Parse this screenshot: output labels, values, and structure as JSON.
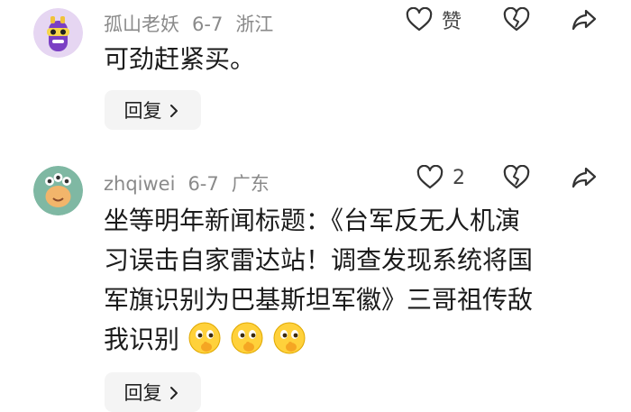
{
  "comments": [
    {
      "username": "孤山老妖",
      "date": "6-7",
      "location": "浙江",
      "text": "可劲赶紧买。",
      "reply_label": "回复",
      "like_label": "赞",
      "avatar_icon": "purple-cartoon-avatar"
    },
    {
      "username": "zhqiwei",
      "date": "6-7",
      "location": "广东",
      "text_lines": [
        "坐等明年新闻标题：《台军反无人机演",
        "习误击自家雷达站！调查发现系统将国",
        "军旗识别为巴基斯坦军徽》三哥祖传敌",
        "我识别"
      ],
      "emojis": [
        "thinking-face-emoji",
        "thinking-face-emoji",
        "thinking-face-emoji"
      ],
      "reply_label": "回复",
      "like_count": "2",
      "avatar_icon": "teal-cartoon-avatar"
    }
  ],
  "icons": {
    "heart": "heart-icon",
    "dislike": "broken-heart-icon",
    "share": "share-arrow-icon",
    "chevron": "chevron-right-icon"
  }
}
